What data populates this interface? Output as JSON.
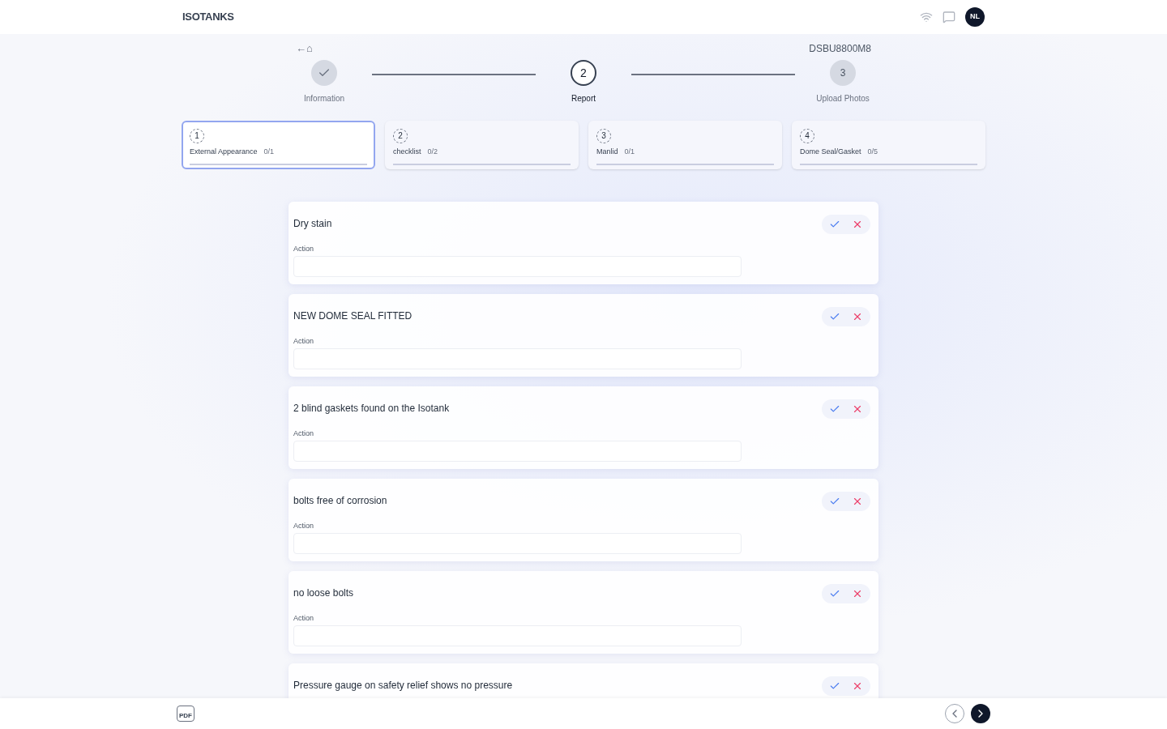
{
  "header": {
    "logo": "ISOTANKS",
    "avatar": "NL"
  },
  "back_link": {
    "label": "←⌂"
  },
  "container_id": "DSBU8800M8",
  "steps": [
    {
      "label": "Information",
      "kind": "done"
    },
    {
      "number": "2",
      "label": "Report",
      "kind": "current"
    },
    {
      "number": "3",
      "label": "Upload Photos",
      "kind": "pending"
    }
  ],
  "tabs": [
    {
      "number": "1",
      "label": "External Appearance",
      "count": "0/1",
      "selected": true
    },
    {
      "number": "2",
      "label": "checklist",
      "count": "0/2",
      "selected": false
    },
    {
      "number": "3",
      "label": "Manlid",
      "count": "0/1",
      "selected": false
    },
    {
      "number": "4",
      "label": "Dome Seal/Gasket",
      "count": "0/5",
      "selected": false
    }
  ],
  "items": [
    {
      "title": "Dry stain",
      "action_label": "Action"
    },
    {
      "title": "NEW DOME SEAL FITTED",
      "action_label": "Action"
    },
    {
      "title": "2 blind gaskets found on the Isotank",
      "action_label": "Action"
    },
    {
      "title": "bolts free of corrosion",
      "action_label": "Action"
    },
    {
      "title": "no loose bolts",
      "action_label": "Action"
    },
    {
      "title": "Pressure gauge on safety relief shows no pressure"
    }
  ],
  "footer": {
    "pdf_label": "PDF"
  }
}
